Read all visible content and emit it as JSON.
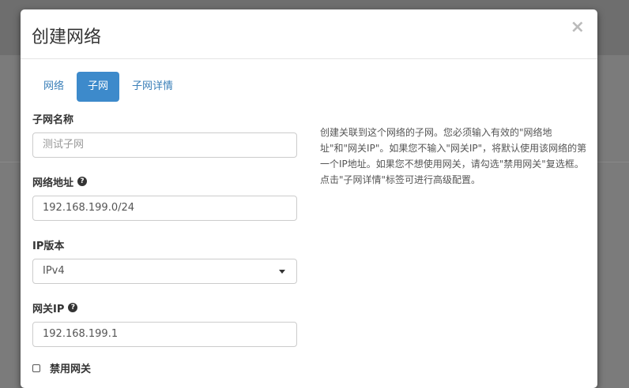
{
  "modal": {
    "title": "创建网络",
    "close": "×"
  },
  "tabs": [
    {
      "label": "网络"
    },
    {
      "label": "子网",
      "active": true
    },
    {
      "label": "子网详情"
    }
  ],
  "form": {
    "subnet_name": {
      "label": "子网名称",
      "placeholder": "测试子网"
    },
    "network_address": {
      "label": "网络地址",
      "value": "192.168.199.0/24"
    },
    "ip_version": {
      "label": "IP版本",
      "value": "IPv4"
    },
    "gateway_ip": {
      "label": "网关IP",
      "value": "192.168.199.1"
    },
    "disable_gateway": {
      "label": "禁用网关",
      "checked": false
    }
  },
  "help_text": "创建关联到这个网络的子网。您必须输入有效的\"网络地址\"和\"网关IP\"。如果您不输入\"网关IP\"，将默认使用该网络的第一个IP地址。如果您不想使用网关，请勾选\"禁用网关\"复选框。点击\"子网详情\"标签可进行高级配置。",
  "colors": {
    "accent": "#3d8acb"
  }
}
